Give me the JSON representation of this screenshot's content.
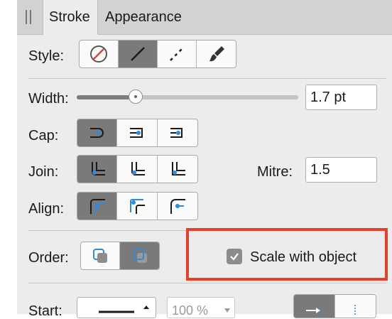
{
  "tabs": {
    "active": "Stroke",
    "inactive": "Appearance"
  },
  "style": {
    "label": "Style:"
  },
  "width": {
    "label": "Width:",
    "value": "1.7 pt",
    "slider_fraction": 0.25
  },
  "cap": {
    "label": "Cap:"
  },
  "join": {
    "label": "Join:",
    "mitre_label": "Mitre:",
    "mitre_value": "1.5"
  },
  "align": {
    "label": "Align:"
  },
  "order": {
    "label": "Order:"
  },
  "scale": {
    "label": "Scale with object",
    "checked": true
  },
  "start": {
    "label": "Start:",
    "scale_value": "100 %"
  },
  "colors": {
    "selected": "#7a7a7a",
    "highlight": "#e5402b",
    "accent": "#2f8ad8"
  }
}
